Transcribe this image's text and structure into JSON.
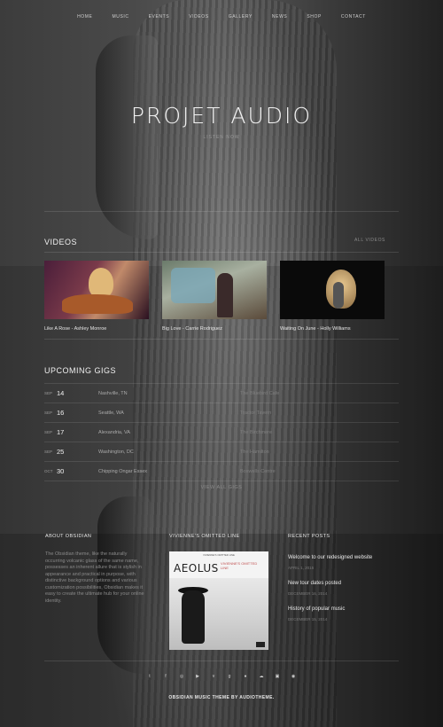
{
  "nav": {
    "items": [
      "HOME",
      "MUSIC",
      "EVENTS",
      "VIDEOS",
      "GALLERY",
      "NEWS",
      "SHOP",
      "CONTACT"
    ]
  },
  "hero": {
    "title": "PROJET AUDIO",
    "subtitle": "LISTEN NOW"
  },
  "videos": {
    "title": "VIDEOS",
    "all_link": "ALL VIDEOS",
    "items": [
      {
        "caption": "Like A Rose - Ashley Monroe"
      },
      {
        "caption": "Big Love - Carrie Rodriguez"
      },
      {
        "caption": "Waiting On June - Holly Williams"
      }
    ]
  },
  "gigs": {
    "title": "UPCOMING GIGS",
    "rows": [
      {
        "month": "SEP",
        "day": "14",
        "city": "Nashville, TN",
        "venue": "The Bluebird Cafe"
      },
      {
        "month": "SEP",
        "day": "16",
        "city": "Seattle, WA",
        "venue": "Tractor Tavern"
      },
      {
        "month": "SEP",
        "day": "17",
        "city": "Alexandria, VA",
        "venue": "The Birchmere"
      },
      {
        "month": "SEP",
        "day": "25",
        "city": "Washington, DC",
        "venue": "The Hamilton"
      },
      {
        "month": "OCT",
        "day": "30",
        "city": "Chipping Ongar Essex",
        "venue": "Boswells Centre"
      }
    ],
    "view_all": "VIEW ALL GIGS"
  },
  "footer": {
    "about_title": "ABOUT OBSIDIAN",
    "about_text": "The Obsidian theme, like the naturally occurring volcanic glass of the same name, possesses an inherent allure that is stylish in appearance and practical in purpose, with distinctive background options and various customization possibilities, Obsidian makes it easy to create the ultimate hub for your online identity.",
    "album_title": "VIVIENNE'S OMITTED LINE",
    "album": {
      "top": "VIVIENNE'S OMITTED LINE",
      "name": "AEOLUS",
      "sub": "VIVIENNE'S OMITTED LINE"
    },
    "posts_title": "RECENT POSTS",
    "posts": [
      {
        "title": "Welcome to our redesigned website",
        "date": "APRIL 1, 2015"
      },
      {
        "title": "New tour dates posted",
        "date": "DECEMBER 16, 2014"
      },
      {
        "title": "History of popular music",
        "date": "DECEMBER 15, 2014"
      }
    ],
    "social_icons": [
      "twitter-icon",
      "facebook-icon",
      "instagram-icon",
      "youtube-icon",
      "vimeo-icon",
      "google-plus-icon",
      "apple-icon",
      "soundcloud-icon",
      "youtube-play-icon",
      "spotify-icon"
    ],
    "social_glyphs": [
      "t",
      "f",
      "◎",
      "▶",
      "v",
      "g",
      "●",
      "☁",
      "▣",
      "◉"
    ],
    "credit": "OBSIDIAN MUSIC THEME BY AUDIOTHEME."
  }
}
